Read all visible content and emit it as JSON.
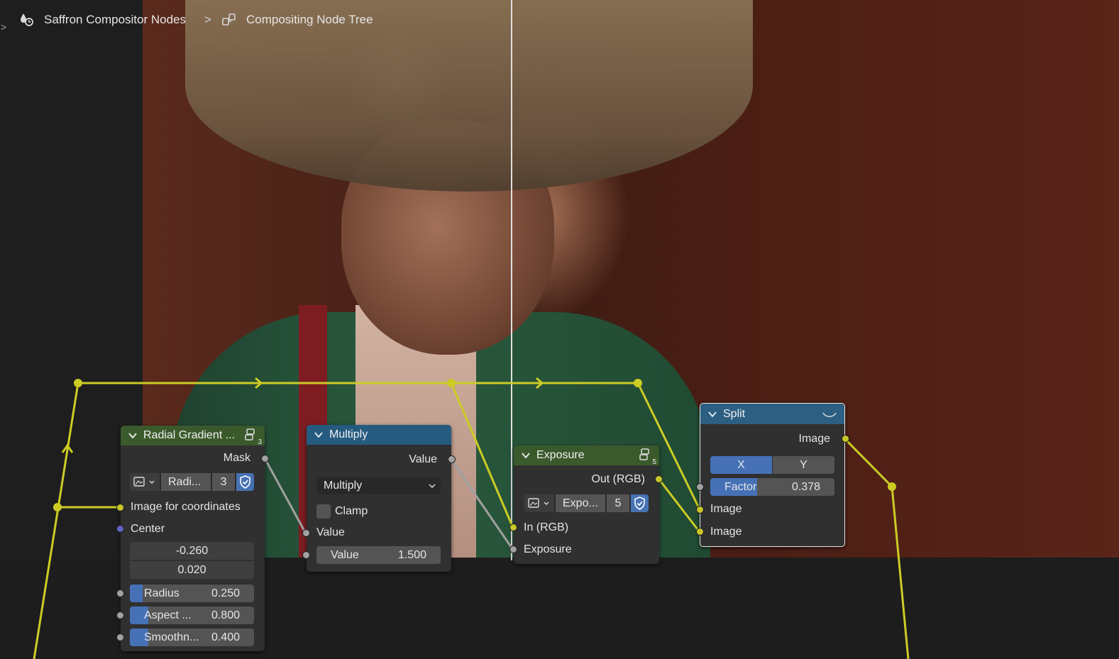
{
  "header": {
    "expand_arrow": ">",
    "breadcrumb_1": "Saffron Compositor Nodes",
    "breadcrumb_sep": ">",
    "breadcrumb_2": "Compositing Node Tree"
  },
  "nodes": {
    "radial_gradient": {
      "title": "Radial Gradient ...",
      "user_count_badge": "3",
      "output_mask": "Mask",
      "datablock_name": "Radi...",
      "datablock_users": "3",
      "input_image_coords": "Image for coordinates",
      "input_center": "Center",
      "center_x": "-0.260",
      "center_y": "0.020",
      "radius_label": "Radius",
      "radius_value": "0.250",
      "radius_fraction": 0.1,
      "aspect_label": "Aspect ...",
      "aspect_value": "0.800",
      "aspect_fraction": 0.15,
      "smooth_label": "Smoothn...",
      "smooth_value": "0.400",
      "smooth_fraction": 0.15
    },
    "multiply": {
      "title": "Multiply",
      "output_value": "Value",
      "operation": "Multiply",
      "clamp_label": "Clamp",
      "clamp_checked": false,
      "input_value": "Value",
      "value_label": "Value",
      "value_value": "1.500"
    },
    "exposure": {
      "title": "Exposure",
      "user_count_badge": "5",
      "output_rgb": "Out (RGB)",
      "datablock_name": "Expo...",
      "datablock_users": "5",
      "input_rgb": "In (RGB)",
      "input_exposure": "Exposure"
    },
    "split": {
      "title": "Split",
      "output_image": "Image",
      "axis_x": "X",
      "axis_y": "Y",
      "axis_selected": "X",
      "factor_label": "Factor",
      "factor_value": "0.378",
      "factor_fraction": 0.378,
      "input_image_1": "Image",
      "input_image_2": "Image"
    }
  },
  "colors": {
    "wire_yellow": "#cccc25",
    "wire_gray": "#a0a0a0",
    "header_green": "#3b5a2c",
    "header_blue": "#265b80",
    "header_split": "#2c5f82",
    "slider_blue": "#4671b7"
  }
}
